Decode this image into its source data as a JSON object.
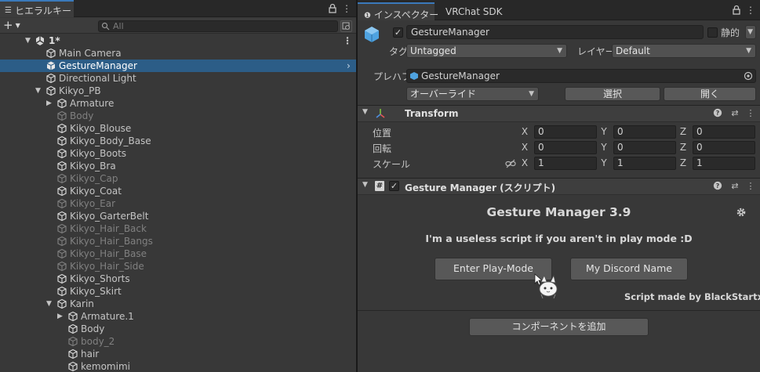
{
  "hierarchy": {
    "tab_label": "ヒエラルキー",
    "search_placeholder": "All",
    "add_label": "+",
    "scene_name": "1*",
    "items": [
      {
        "label": "Main Camera",
        "indent": 1,
        "dim": false,
        "arrow": "",
        "selected": false
      },
      {
        "label": "GestureManager",
        "indent": 1,
        "dim": false,
        "arrow": "",
        "selected": true
      },
      {
        "label": "Directional Light",
        "indent": 1,
        "dim": false,
        "arrow": "",
        "selected": false
      },
      {
        "label": "Kikyo_PB",
        "indent": 1,
        "dim": false,
        "arrow": "down",
        "selected": false
      },
      {
        "label": "Armature",
        "indent": 2,
        "dim": false,
        "arrow": "right",
        "selected": false
      },
      {
        "label": "Body",
        "indent": 2,
        "dim": true,
        "arrow": "",
        "selected": false
      },
      {
        "label": "Kikyo_Blouse",
        "indent": 2,
        "dim": false,
        "arrow": "",
        "selected": false
      },
      {
        "label": "Kikyo_Body_Base",
        "indent": 2,
        "dim": false,
        "arrow": "",
        "selected": false
      },
      {
        "label": "Kikyo_Boots",
        "indent": 2,
        "dim": false,
        "arrow": "",
        "selected": false
      },
      {
        "label": "Kikyo_Bra",
        "indent": 2,
        "dim": false,
        "arrow": "",
        "selected": false
      },
      {
        "label": "Kikyo_Cap",
        "indent": 2,
        "dim": true,
        "arrow": "",
        "selected": false
      },
      {
        "label": "Kikyo_Coat",
        "indent": 2,
        "dim": false,
        "arrow": "",
        "selected": false
      },
      {
        "label": "Kikyo_Ear",
        "indent": 2,
        "dim": true,
        "arrow": "",
        "selected": false
      },
      {
        "label": "Kikyo_GarterBelt",
        "indent": 2,
        "dim": false,
        "arrow": "",
        "selected": false
      },
      {
        "label": "Kikyo_Hair_Back",
        "indent": 2,
        "dim": true,
        "arrow": "",
        "selected": false
      },
      {
        "label": "Kikyo_Hair_Bangs",
        "indent": 2,
        "dim": true,
        "arrow": "",
        "selected": false
      },
      {
        "label": "Kikyo_Hair_Base",
        "indent": 2,
        "dim": true,
        "arrow": "",
        "selected": false
      },
      {
        "label": "Kikyo_Hair_Side",
        "indent": 2,
        "dim": true,
        "arrow": "",
        "selected": false
      },
      {
        "label": "Kikyo_Shorts",
        "indent": 2,
        "dim": false,
        "arrow": "",
        "selected": false
      },
      {
        "label": "Kikyo_Skirt",
        "indent": 2,
        "dim": false,
        "arrow": "",
        "selected": false
      },
      {
        "label": "Karin",
        "indent": 2,
        "dim": false,
        "arrow": "down",
        "selected": false
      },
      {
        "label": "Armature.1",
        "indent": 3,
        "dim": false,
        "arrow": "right",
        "selected": false
      },
      {
        "label": "Body",
        "indent": 3,
        "dim": false,
        "arrow": "",
        "selected": false
      },
      {
        "label": "body_2",
        "indent": 3,
        "dim": true,
        "arrow": "",
        "selected": false
      },
      {
        "label": "hair",
        "indent": 3,
        "dim": false,
        "arrow": "",
        "selected": false
      },
      {
        "label": "kemomimi",
        "indent": 3,
        "dim": false,
        "arrow": "",
        "selected": false
      }
    ]
  },
  "inspector": {
    "tab_inspector": "インスペクター",
    "tab_vrchat": "VRChat SDK",
    "object_name": "GestureManager",
    "static_label": "静的",
    "tag_label": "タグ",
    "tag_value": "Untagged",
    "layer_label": "レイヤー",
    "layer_value": "Default",
    "prefab_label": "プレハブ",
    "prefab_value": "GestureManager",
    "overrides_label": "オーバーライド",
    "select_label": "選択",
    "open_label": "開く",
    "transform": {
      "title": "Transform",
      "position_label": "位置",
      "rotation_label": "回転",
      "scale_label": "スケール",
      "axes": [
        "X",
        "Y",
        "Z"
      ],
      "position": [
        "0",
        "0",
        "0"
      ],
      "rotation": [
        "0",
        "0",
        "0"
      ],
      "scale": [
        "1",
        "1",
        "1"
      ]
    },
    "gesture": {
      "title": "Gesture Manager (スクリプト)",
      "heading": "Gesture Manager 3.9",
      "message": "I'm a useless script if you aren't in play mode :D",
      "play_button": "Enter Play-Mode",
      "discord_button": "My Discord Name",
      "credit": "Script made by BlackStartx"
    },
    "add_component": "コンポーネントを追加"
  },
  "colors": {
    "selection": "#2c5d87",
    "accent_tab": "#3a79bb",
    "cube_blue": "#4fa3e0"
  }
}
